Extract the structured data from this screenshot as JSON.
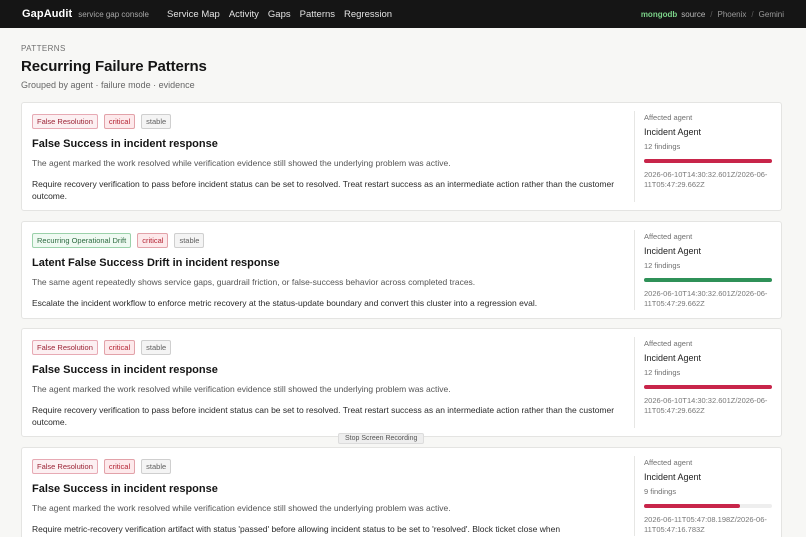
{
  "app": {
    "brand": "GapAudit",
    "brand_sub": "service gap console",
    "nav": [
      "Service Map",
      "Activity",
      "Gaps",
      "Patterns",
      "Regression"
    ],
    "db": "mongodb",
    "db_suffix": "source",
    "crumbs": [
      "Phoenix",
      "Gemini"
    ]
  },
  "page": {
    "eyebrow": "PATTERNS",
    "title": "Recurring Failure Patterns",
    "subtitle": "Grouped by agent · failure mode · evidence"
  },
  "colors": {
    "severity_bar": "#c8254a",
    "drift_bar": "#2f9158",
    "topbar": "#151515"
  },
  "cards": [
    {
      "mode": "False Resolution",
      "severity": "critical",
      "stability": "stable",
      "title": "False Success in incident response",
      "description": "The agent marked the work resolved while verification evidence still showed the underlying problem was active.",
      "recommendation": "Require recovery verification to pass before incident status can be set to resolved. Treat restart success as an intermediate action rather than the customer outcome.",
      "agent_label": "Affected agent",
      "agent": "Incident Agent",
      "findings": "12 findings",
      "share": 1.0,
      "range": "2026-06-10T14:30:32.601Z/2026-06-11T05:47:29.662Z"
    },
    {
      "mode": "Recurring Operational Drift",
      "severity": "critical",
      "stability": "stable",
      "title": "Latent False Success Drift in incident response",
      "description": "The same agent repeatedly shows service gaps, guardrail friction, or false-success behavior across completed traces.",
      "recommendation": "Escalate the incident workflow to enforce metric recovery at the status-update boundary and convert this cluster into a regression eval.",
      "agent_label": "Affected agent",
      "agent": "Incident Agent",
      "findings": "12 findings",
      "share": 1.0,
      "range": "2026-06-10T14:30:32.601Z/2026-06-11T05:47:29.662Z"
    },
    {
      "mode": "False Resolution",
      "severity": "critical",
      "stability": "stable",
      "title": "False Success in incident response",
      "description": "The agent marked the work resolved while verification evidence still showed the underlying problem was active.",
      "recommendation": "Require recovery verification to pass before incident status can be set to resolved. Treat restart success as an intermediate action rather than the customer outcome.",
      "agent_label": "Affected agent",
      "agent": "Incident Agent",
      "findings": "12 findings",
      "share": 1.0,
      "range": "2026-06-10T14:30:32.601Z/2026-06-11T05:47:29.662Z"
    },
    {
      "mode": "False Resolution",
      "severity": "critical",
      "stability": "stable",
      "title": "False Success in incident response",
      "description": "The agent marked the work resolved while verification evidence still showed the underlying problem was active.",
      "recommendation": "Require metric-recovery verification artifact with status 'passed' before allowing incident status to be set to 'resolved'. Block ticket close when",
      "agent_label": "Affected agent",
      "agent": "Incident Agent",
      "findings": "9 findings",
      "share": 0.75,
      "range": "2026-06-11T05:47:08.198Z/2026-06-11T05:47:16.783Z"
    }
  ],
  "recording": "Stop Screen Recording"
}
